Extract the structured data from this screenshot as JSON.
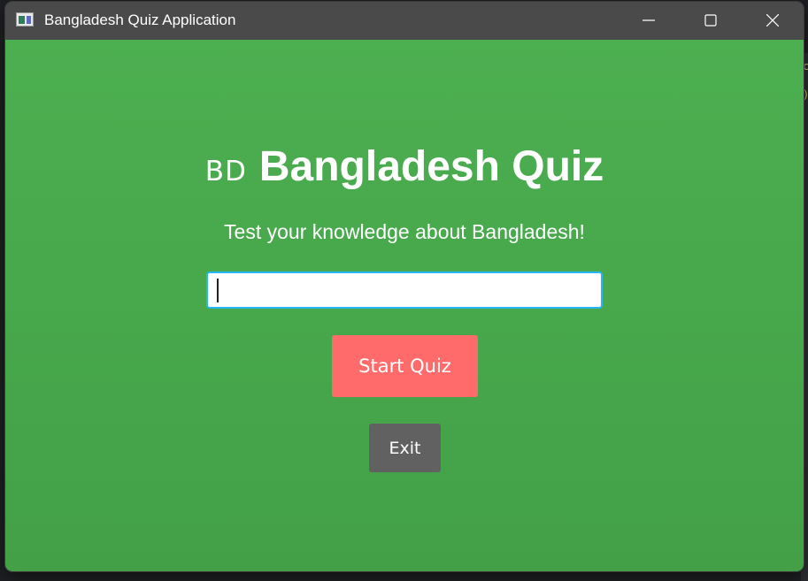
{
  "window": {
    "title": "Bangladesh Quiz Application",
    "icon": "app-window-icon",
    "controls": [
      "minimize-icon",
      "maximize-icon",
      "close-icon"
    ]
  },
  "main": {
    "flag_text": "BD",
    "heading": "Bangladesh Quiz",
    "subtitle": "Test your knowledge about Bangladesh!",
    "name_input": {
      "value": "",
      "placeholder": ""
    },
    "start_label": "Start Quiz",
    "exit_label": "Exit"
  },
  "colors": {
    "background": "#4caf50",
    "start_button": "#ff6b6b",
    "exit_button": "#616161",
    "input_focus_border": "#29b6f6",
    "titlebar": "#4a4a4a"
  }
}
